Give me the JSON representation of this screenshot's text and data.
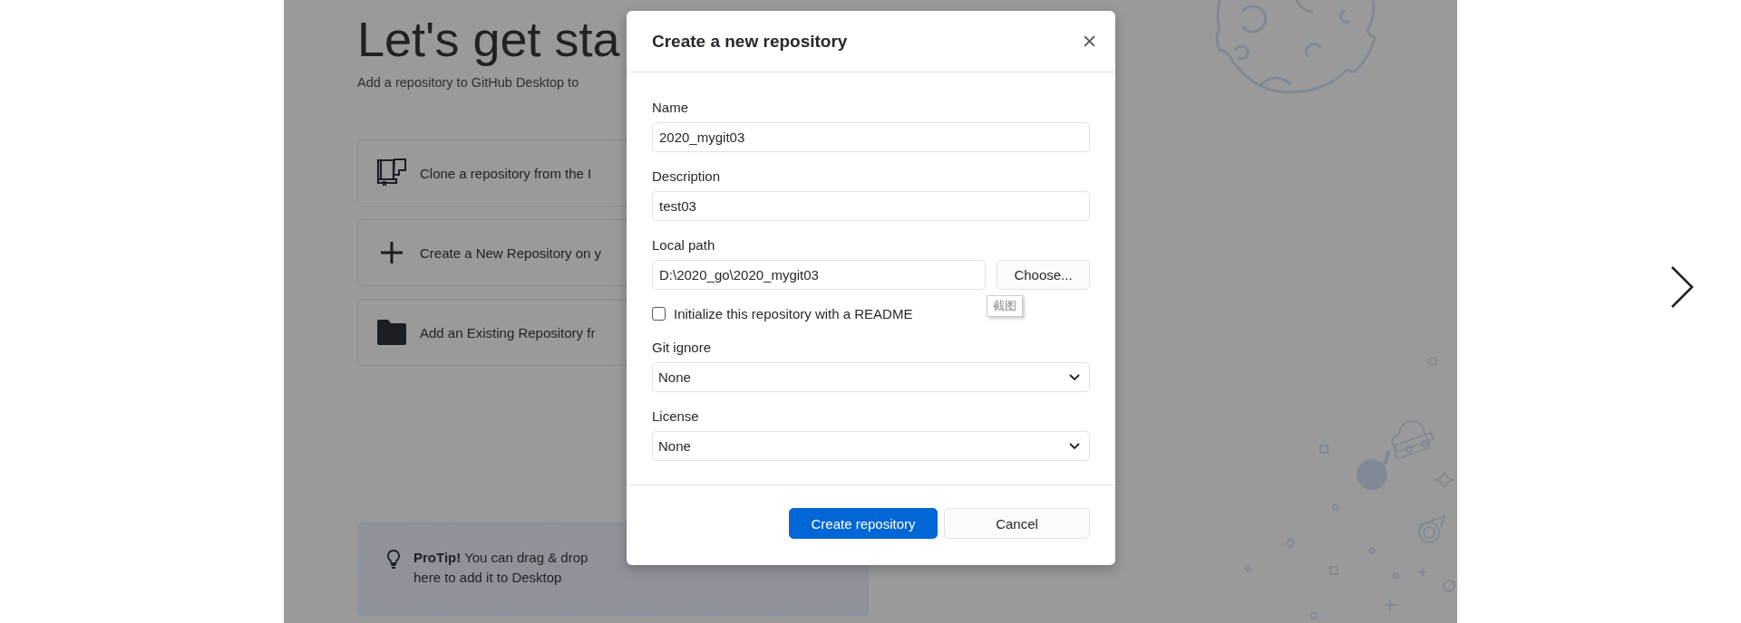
{
  "background": {
    "heading": "Let's get sta",
    "subtitle": "Add a repository to GitHub Desktop to",
    "options": [
      {
        "kind": "clone",
        "label": "Clone a repository from the I"
      },
      {
        "kind": "create",
        "label": "Create a New Repository on y"
      },
      {
        "kind": "add",
        "label": "Add an Existing Repository fr"
      }
    ],
    "protip": {
      "lines": [
        "**ProTip!** You can drag & drop",
        "here to add it to Desktop"
      ]
    }
  },
  "dialog": {
    "title": "Create a new repository",
    "fields": [
      {
        "kind": "text",
        "label": "Name",
        "value": "2020_mygit03"
      },
      {
        "kind": "text",
        "label": "Description",
        "value": "test03"
      },
      {
        "kind": "path",
        "label": "Local path",
        "value": "D:\\2020_go\\2020_mygit03",
        "button": "Choose..."
      },
      {
        "kind": "checkbox",
        "label": "Initialize this repository with a README",
        "checked": false
      },
      {
        "kind": "select",
        "label": "Git ignore",
        "value": "None"
      },
      {
        "kind": "select",
        "label": "License",
        "value": "None"
      }
    ],
    "buttons": [
      {
        "kind": "primary",
        "label": "Create repository"
      },
      {
        "kind": "secondary",
        "label": "Cancel"
      }
    ]
  },
  "tooltip": {
    "text": "截图"
  }
}
